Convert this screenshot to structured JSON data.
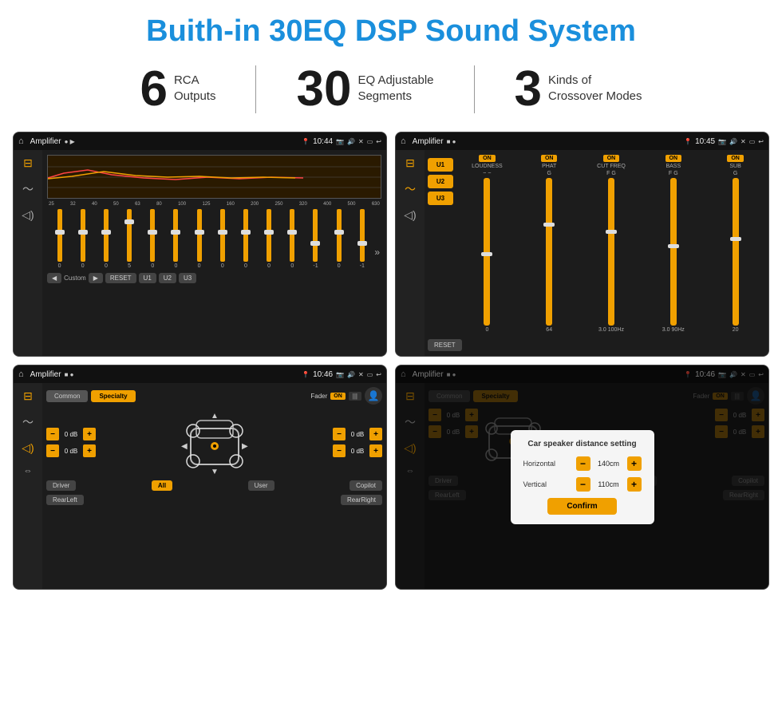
{
  "page": {
    "title": "Buith-in 30EQ DSP Sound System"
  },
  "stats": [
    {
      "number": "6",
      "line1": "RCA",
      "line2": "Outputs"
    },
    {
      "number": "30",
      "line1": "EQ Adjustable",
      "line2": "Segments"
    },
    {
      "number": "3",
      "line1": "Kinds of",
      "line2": "Crossover Modes"
    }
  ],
  "screens": [
    {
      "id": "eq-screen",
      "time": "10:44",
      "title": "Amplifier",
      "type": "eq",
      "freqs": [
        "25",
        "32",
        "40",
        "50",
        "63",
        "80",
        "100",
        "125",
        "160",
        "200",
        "250",
        "320",
        "400",
        "500",
        "630"
      ],
      "values": [
        "0",
        "0",
        "0",
        "5",
        "0",
        "0",
        "0",
        "0",
        "0",
        "0",
        "0",
        "-1",
        "0",
        "-1"
      ],
      "preset": "Custom",
      "buttons": [
        "RESET",
        "U1",
        "U2",
        "U3"
      ]
    },
    {
      "id": "crossover-screen",
      "time": "10:45",
      "title": "Amplifier",
      "type": "crossover",
      "presets": [
        "U1",
        "U2",
        "U3"
      ],
      "channels": [
        "LOUDNESS",
        "PHAT",
        "CUT FREQ",
        "BASS",
        "SUB"
      ]
    },
    {
      "id": "speaker-screen",
      "time": "10:46",
      "title": "Amplifier",
      "type": "speaker",
      "tabs": [
        "Common",
        "Specialty"
      ],
      "fader": "Fader",
      "dbValues": [
        "0 dB",
        "0 dB",
        "0 dB",
        "0 dB"
      ],
      "bottomBtns": [
        "Driver",
        "All",
        "User",
        "RearLeft",
        "RearRight",
        "Copilot"
      ]
    },
    {
      "id": "speaker-dialog-screen",
      "time": "10:46",
      "title": "Amplifier",
      "type": "speaker-dialog",
      "tabs": [
        "Common",
        "Specialty"
      ],
      "dialog": {
        "title": "Car speaker distance setting",
        "horizontal_label": "Horizontal",
        "horizontal_value": "140cm",
        "vertical_label": "Vertical",
        "vertical_value": "110cm",
        "confirm_label": "Confirm"
      },
      "dbValues": [
        "0 dB",
        "0 dB"
      ],
      "bottomBtns": [
        "Driver",
        "All",
        "User",
        "RearLeft",
        "RearRight",
        "Copilot"
      ]
    }
  ]
}
